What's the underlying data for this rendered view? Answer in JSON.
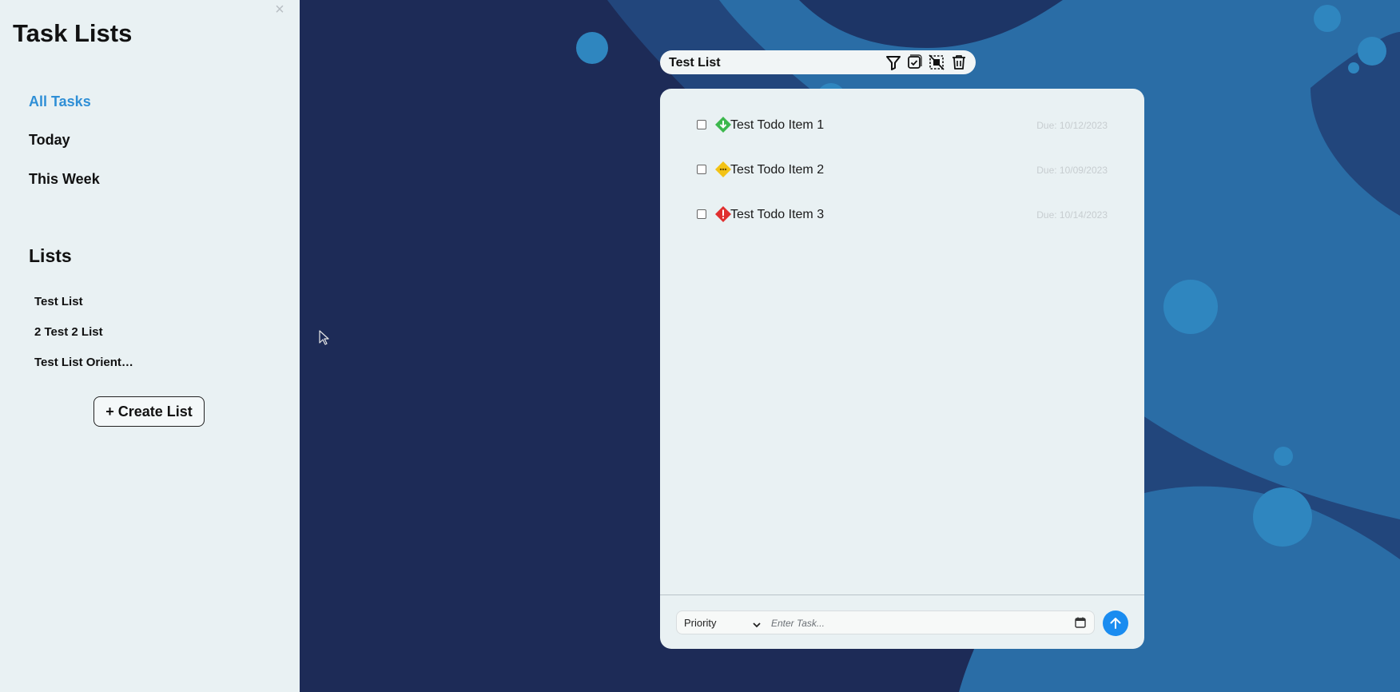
{
  "colors": {
    "sidebar_bg": "#e9f1f3",
    "accent": "#2f8fd6",
    "background_dark": "#1d2b57",
    "background_blue": "#2a6da6",
    "priority_low": "#3db84d",
    "priority_medium": "#f3c316",
    "priority_high": "#e02f2f",
    "send_button": "#1a8cf0"
  },
  "sidebar": {
    "close_label": "×",
    "title": "Task Lists",
    "nav": [
      {
        "label": "All Tasks",
        "active": true
      },
      {
        "label": "Today",
        "active": false
      },
      {
        "label": "This Week",
        "active": false
      }
    ],
    "lists_heading": "Lists",
    "lists": [
      {
        "label": "Test List"
      },
      {
        "label": "2 Test 2 List"
      },
      {
        "label": "Test List Orient…"
      }
    ],
    "create_button": "+ Create List"
  },
  "header": {
    "title": "Test List",
    "icons": [
      "filter-icon",
      "check-square-icon",
      "deselect-icon",
      "trash-icon"
    ]
  },
  "todos": [
    {
      "name": "Test Todo Item 1",
      "due": "Due: 10/12/2023",
      "priority": "low",
      "priority_icon": "arrow-down-diamond-icon"
    },
    {
      "name": "Test Todo Item 2",
      "due": "Due: 10/09/2023",
      "priority": "medium",
      "priority_icon": "dots-diamond-icon"
    },
    {
      "name": "Test Todo Item 3",
      "due": "Due: 10/14/2023",
      "priority": "high",
      "priority_icon": "exclamation-diamond-icon"
    }
  ],
  "input": {
    "priority_label": "Priority",
    "placeholder": "Enter Task...",
    "calendar_icon": "calendar-icon",
    "send_icon": "arrow-up-icon"
  }
}
